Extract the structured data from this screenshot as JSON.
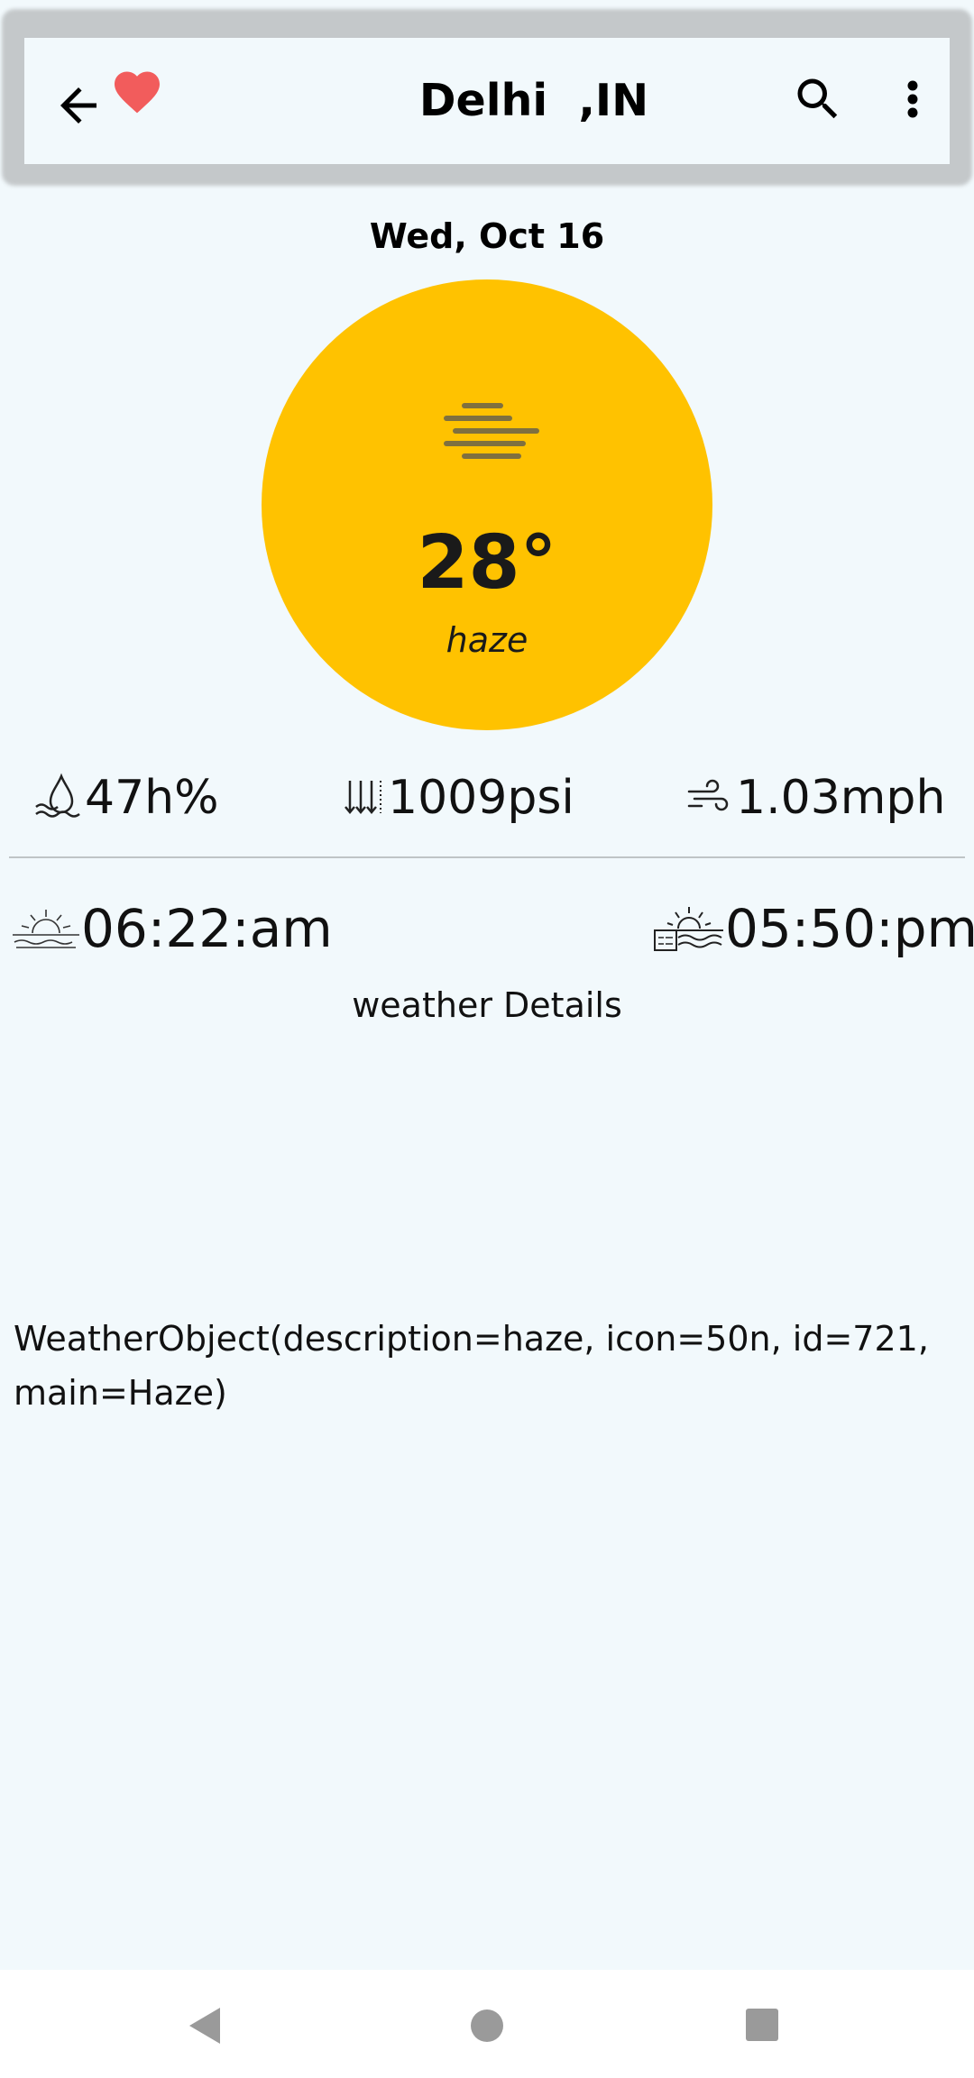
{
  "header": {
    "title": "Delhi  ,IN",
    "back_icon": "arrow-left-icon",
    "favorite_icon": "heart-icon",
    "search_icon": "search-icon",
    "more_icon": "more-vertical-icon"
  },
  "date": "Wed, Oct 16",
  "current": {
    "temperature": "28°",
    "condition": "haze",
    "icon": "haze-icon"
  },
  "stats": {
    "humidity": "47h%",
    "pressure": "1009psi",
    "wind": "1.03mph"
  },
  "sun": {
    "sunrise": "06:22:am",
    "sunset": "05:50:pm"
  },
  "details_label": "weather Details",
  "raw_object": "WeatherObject(description=haze, icon=50n, id=721, main=Haze)",
  "colors": {
    "background": "#F2F9FC",
    "accent_circle": "#FFC200",
    "favorite": "#F25C5C"
  }
}
